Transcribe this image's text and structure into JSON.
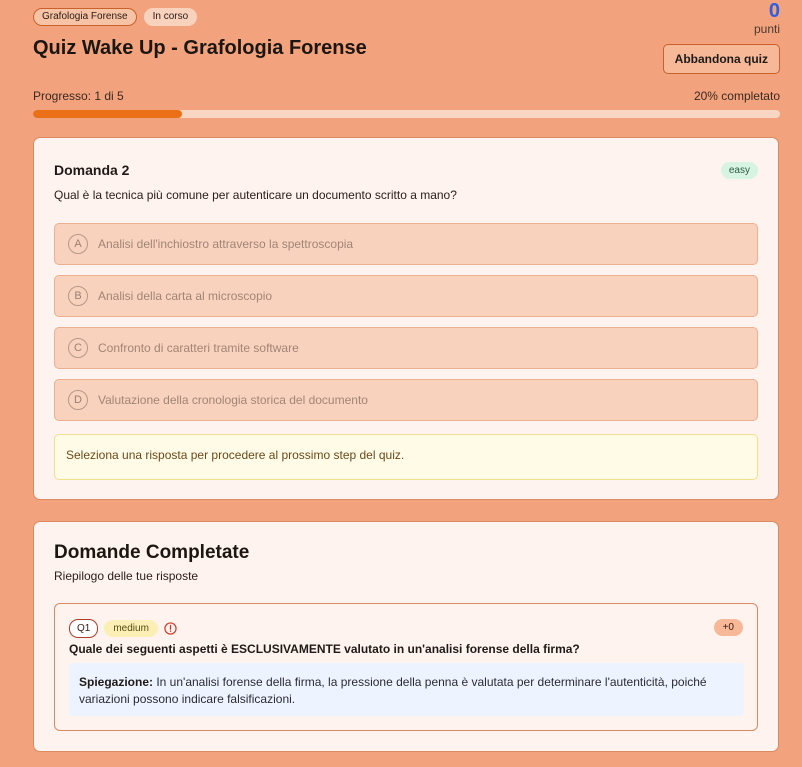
{
  "header": {
    "badges": [
      "Grafologia Forense",
      "In corso"
    ],
    "title": "Quiz Wake Up - Grafologia Forense",
    "score_value": "0",
    "score_label": "punti",
    "abandon_label": "Abbandona quiz",
    "progress_label": "Progresso: 1 di 5",
    "progress_pct_label": "20% completato",
    "progress_fraction": 0.2
  },
  "question": {
    "title": "Domanda 2",
    "difficulty": "easy",
    "text": "Qual è la tecnica più comune per autenticare un documento scritto a mano?",
    "options": [
      {
        "letter": "A",
        "text": "Analisi dell'inchiostro attraverso la spettroscopia"
      },
      {
        "letter": "B",
        "text": "Analisi della carta al microscopio"
      },
      {
        "letter": "C",
        "text": "Confronto di caratteri tramite software"
      },
      {
        "letter": "D",
        "text": "Valutazione della cronologia storica del documento"
      }
    ],
    "notice": "Seleziona una risposta per procedere al prossimo step del quiz."
  },
  "completed": {
    "title": "Domande Completate",
    "subtitle": "Riepilogo delle tue risposte",
    "items": [
      {
        "qnum": "Q1",
        "difficulty": "medium",
        "points": "+0",
        "question": "Quale dei seguenti aspetti è ESCLUSIVAMENTE valutato in un'analisi forense della firma?",
        "explanation_label": "Spiegazione:",
        "explanation": "In un'analisi forense della firma, la pressione della penna è valutata per determinare l'autenticità, poiché variazioni possono indicare falsificazioni."
      }
    ]
  },
  "colors": {
    "background": "#f2a27c",
    "accent": "#ea6f17",
    "score": "#2d5fe0"
  }
}
